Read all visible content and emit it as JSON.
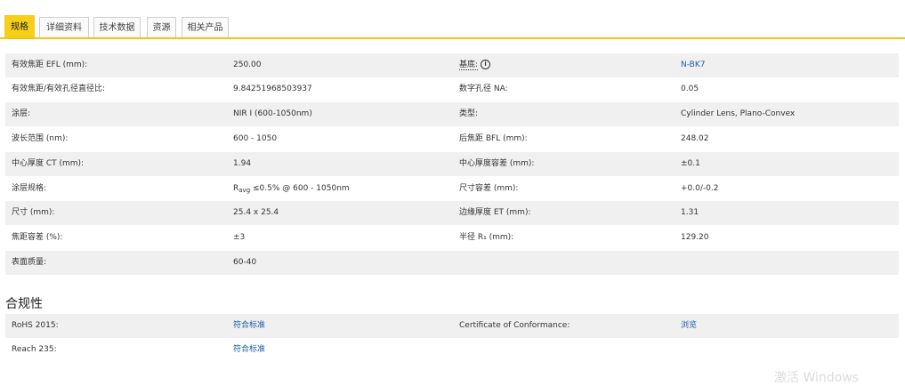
{
  "tabs": [
    {
      "label": "规格",
      "active": true
    },
    {
      "label": "详细资料",
      "active": false
    },
    {
      "label": "技术数据",
      "active": false
    },
    {
      "label": "资源",
      "active": false
    },
    {
      "label": "相关产品",
      "active": false
    }
  ],
  "specs": {
    "r0": {
      "l1": "有效焦距 EFL (mm):",
      "v1": "250.00",
      "l2": "基底:",
      "v2": "N-BK7"
    },
    "r1": {
      "l1": "有效焦距/有效孔径直径比:",
      "v1": "9.84251968503937",
      "l2": "数字孔径 NA:",
      "v2": "0.05"
    },
    "r2": {
      "l1": "涂层:",
      "v1": "NIR I (600-1050nm)",
      "l2": "类型:",
      "v2": "Cylinder Lens, Plano-Convex"
    },
    "r3": {
      "l1": "波长范围 (nm):",
      "v1": "600 - 1050",
      "l2": "后焦距 BFL (mm):",
      "v2": "248.02"
    },
    "r4": {
      "l1": "中心厚度 CT (mm):",
      "v1": "1.94",
      "l2": "中心厚度容差 (mm):",
      "v2": "±0.1"
    },
    "r5": {
      "l1": "涂层规格:",
      "v1_main": "R",
      "v1_sub": "avg",
      "v1_rest": " ≤0.5% @ 600 - 1050nm",
      "l2": "尺寸容差 (mm):",
      "v2": "+0.0/-0.2"
    },
    "r6": {
      "l1": "尺寸 (mm):",
      "v1": "25.4 x 25.4",
      "l2": "边缘厚度 ET (mm):",
      "v2": "1.31"
    },
    "r7": {
      "l1": "焦距容差 (%):",
      "v1": "±3",
      "l2": "半径 R₁ (mm):",
      "v2": "129.20"
    },
    "r8": {
      "l1": "表面质量:",
      "v1": "60-40",
      "l2": "",
      "v2": ""
    }
  },
  "compliance": {
    "title": "合规性",
    "r0": {
      "l1": "RoHS 2015:",
      "v1": "符合标准",
      "l2": "Certificate of Conformance:",
      "v2": "浏览"
    },
    "r1": {
      "l1": "Reach 235:",
      "v1": "符合标准"
    }
  },
  "icons": {
    "info": "info-circle-icon"
  },
  "watermark": "激活 Windows",
  "colors": {
    "accent": "#f6cf19",
    "link": "#1b5ea8",
    "row_shade": "#f0f0f0"
  }
}
